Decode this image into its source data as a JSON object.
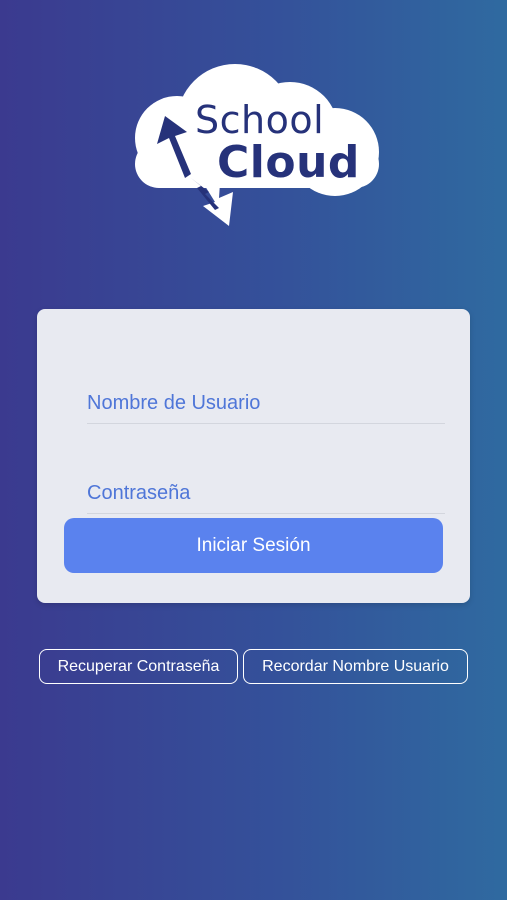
{
  "logo": {
    "line1": "School",
    "line2": "Cloud"
  },
  "login_form": {
    "username_placeholder": "Nombre de Usuario",
    "password_placeholder": "Contraseña",
    "submit_label": "Iniciar Sesión"
  },
  "links": {
    "recover_password": "Recuperar Contraseña",
    "remember_username": "Recordar Nombre Usuario"
  },
  "colors": {
    "background_start": "#3b3a8f",
    "background_end": "#2f6aa0",
    "card": "#e8eaf1",
    "accent": "#5a82ee",
    "placeholder": "#4f76d8",
    "logo_text": "#26327a"
  }
}
